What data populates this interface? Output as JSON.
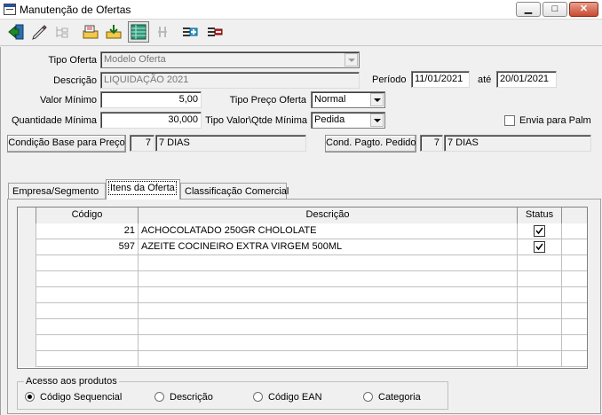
{
  "window": {
    "title": "Manutenção de Ofertas",
    "controls": {
      "minimize": "▁",
      "maximize": "□",
      "close": "✕"
    }
  },
  "toolbar": {
    "buttons": [
      {
        "icon": "exit-door-icon",
        "enabled": true
      },
      {
        "icon": "edit-pencil-icon",
        "enabled": true
      },
      {
        "icon": "tree-icon",
        "enabled": false
      },
      {
        "icon": "folder-open-icon",
        "enabled": true
      },
      {
        "icon": "save-icon",
        "enabled": true
      },
      {
        "icon": "grid-table-icon",
        "enabled": true
      },
      {
        "icon": "find-icon",
        "enabled": false
      },
      {
        "icon": "add-item-icon",
        "enabled": true
      },
      {
        "icon": "remove-item-icon",
        "enabled": true
      }
    ]
  },
  "form": {
    "tipo_oferta": {
      "label": "Tipo Oferta",
      "value": "Modelo Oferta"
    },
    "descricao": {
      "label": "Descrição",
      "value": "LIQUIDAÇÃO 2021"
    },
    "periodo": {
      "label": "Período",
      "inicio": "11/01/2021",
      "ate_label": "até",
      "fim": "20/01/2021"
    },
    "valor_minimo": {
      "label": "Valor Mínimo",
      "value": "5,00"
    },
    "tipo_preco_oferta": {
      "label": "Tipo Preço Oferta",
      "value": "Normal"
    },
    "quantidade_minima": {
      "label": "Quantidade Mínima",
      "value": "30,000"
    },
    "tipo_valor_qtde_minima": {
      "label": "Tipo Valor\\Qtde Mínima",
      "value": "Pedida"
    },
    "envia_para_palm": {
      "label": "Envia para Palm",
      "checked": false
    },
    "condicao_base_preco": {
      "button_label": "Condição Base para Preço",
      "code": "7",
      "description": "7 DIAS"
    },
    "cond_pagto_pedido": {
      "button_label": "Cond. Pagto. Pedido",
      "code": "7",
      "description": "7 DIAS"
    }
  },
  "tabs": [
    {
      "label": "Empresa/Segmento",
      "active": false
    },
    {
      "label": "Itens da Oferta",
      "active": true
    },
    {
      "label": "Classificação Comercial",
      "active": false
    }
  ],
  "grid": {
    "columns": [
      "Código",
      "Descrição",
      "Status"
    ],
    "rows": [
      {
        "codigo": "21",
        "descricao": "ACHOCOLATADO 250GR CHOLOLATE",
        "status": true
      },
      {
        "codigo": "597",
        "descricao": "AZEITE COCINEIRO EXTRA VIRGEM 500ML",
        "status": true
      }
    ],
    "empty_rows": 7
  },
  "acesso": {
    "legend": "Acesso aos produtos",
    "options": [
      {
        "label": "Código Sequencial",
        "selected": true
      },
      {
        "label": "Descrição",
        "selected": false
      },
      {
        "label": "Código EAN",
        "selected": false
      },
      {
        "label": "Categoria",
        "selected": false
      }
    ]
  }
}
